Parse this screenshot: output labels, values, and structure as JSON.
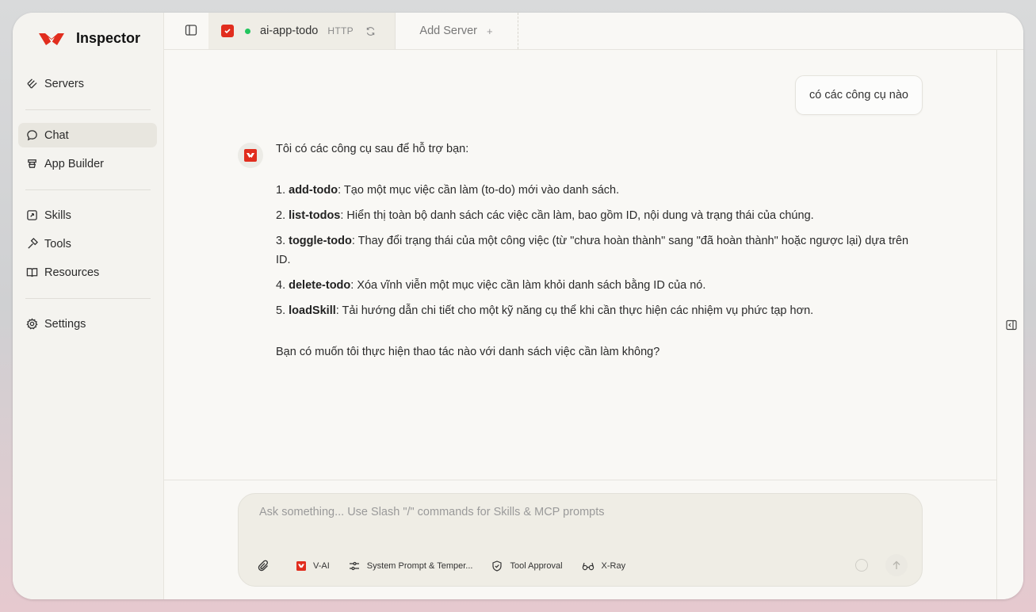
{
  "brand": {
    "name": "Inspector"
  },
  "sidebar": {
    "items": [
      {
        "label": "Servers",
        "icon": "servers-icon"
      },
      {
        "label": "Chat",
        "icon": "chat-bubble-icon",
        "active": true
      },
      {
        "label": "App Builder",
        "icon": "app-builder-icon"
      },
      {
        "label": "Skills",
        "icon": "skills-icon"
      },
      {
        "label": "Tools",
        "icon": "hammer-icon"
      },
      {
        "label": "Resources",
        "icon": "book-icon"
      },
      {
        "label": "Settings",
        "icon": "gear-icon"
      }
    ]
  },
  "tabs": {
    "server_name": "ai-app-todo",
    "server_protocol": "HTTP",
    "server_status_color": "#22c55e",
    "add_server_label": "Add Server",
    "add_server_plus": "+"
  },
  "chat": {
    "user_message": "có các công cụ nào",
    "assistant": {
      "intro": "Tôi có các công cụ sau để hỗ trợ bạn:",
      "items": [
        {
          "num": "1.",
          "name": "add-todo",
          "desc": ": Tạo một mục việc cần làm (to-do) mới vào danh sách."
        },
        {
          "num": "2.",
          "name": "list-todos",
          "desc": ": Hiển thị toàn bộ danh sách các việc cần làm, bao gồm ID, nội dung và trạng thái của chúng."
        },
        {
          "num": "3.",
          "name": "toggle-todo",
          "desc": ": Thay đổi trạng thái của một công việc (từ \"chưa hoàn thành\" sang \"đã hoàn thành\" hoặc ngược lại) dựa trên ID."
        },
        {
          "num": "4.",
          "name": "delete-todo",
          "desc": ": Xóa vĩnh viễn một mục việc cần làm khỏi danh sách bằng ID của nó."
        },
        {
          "num": "5.",
          "name": "loadSkill",
          "desc": ": Tải hướng dẫn chi tiết cho một kỹ năng cụ thể khi cần thực hiện các nhiệm vụ phức tạp hơn."
        }
      ],
      "outro": "Bạn có muốn tôi thực hiện thao tác nào với danh sách việc cần làm không?"
    }
  },
  "composer": {
    "placeholder": "Ask something... Use Slash \"/\" commands for Skills & MCP prompts",
    "model_label": "V-AI",
    "system_prompt_label": "System Prompt & Temper...",
    "tool_approval_label": "Tool Approval",
    "xray_label": "X-Ray"
  },
  "colors": {
    "brand_red": "#e12d1e",
    "accent_bg": "#efede5"
  }
}
